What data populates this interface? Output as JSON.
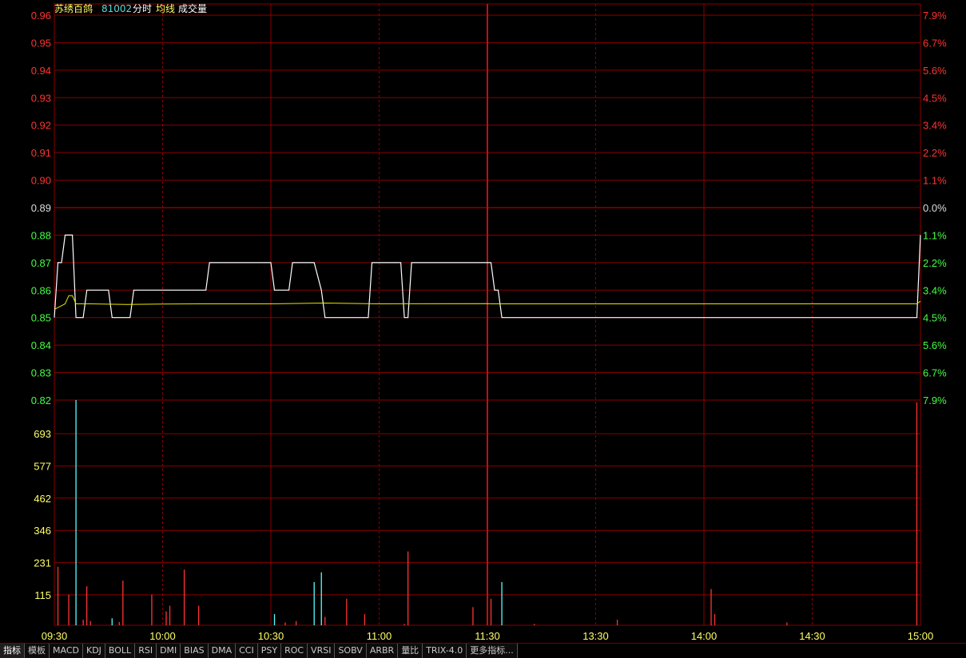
{
  "header": {
    "stock_name": "苏绣百鸽",
    "stock_code": "81002",
    "mode_label": "分时",
    "avg_label": "均线",
    "vol_label": "成交量"
  },
  "colors": {
    "price_line": "#ffffff",
    "avg_line": "#e6e600",
    "grid": "#8b0000",
    "axis_up": "#ff3333",
    "axis_flat": "#dddddd",
    "axis_down": "#44ff44",
    "vol_up": "#ff3333",
    "vol_down": "#55ffff",
    "time_label": "#ffff66"
  },
  "chart_data": [
    {
      "type": "line",
      "title": "",
      "preclose": 0.89,
      "ylim": [
        0.82,
        0.96
      ],
      "y_ticks": [
        "0.96",
        "0.95",
        "0.94",
        "0.93",
        "0.92",
        "0.91",
        "0.90",
        "0.89",
        "0.88",
        "0.87",
        "0.86",
        "0.85",
        "0.84",
        "0.83",
        "0.82"
      ],
      "y_right_ticks": [
        "7.9%",
        "6.7%",
        "5.6%",
        "4.5%",
        "3.4%",
        "2.2%",
        "1.1%",
        "0.0%",
        "1.1%",
        "2.2%",
        "3.4%",
        "4.5%",
        "5.6%",
        "6.7%",
        "7.9%"
      ],
      "x_range_minutes": [
        0,
        240
      ],
      "x_labels": [
        {
          "label": "09:30",
          "minute": 0
        },
        {
          "label": "10:00",
          "minute": 30
        },
        {
          "label": "10:30",
          "minute": 60
        },
        {
          "label": "11:00",
          "minute": 90
        },
        {
          "label": "11:30",
          "minute": 120
        },
        {
          "label": "13:30",
          "minute": 150
        },
        {
          "label": "14:00",
          "minute": 180
        },
        {
          "label": "14:30",
          "minute": 210
        },
        {
          "label": "15:00",
          "minute": 240
        }
      ],
      "series": [
        {
          "key": "price",
          "points": [
            [
              0,
              0.85
            ],
            [
              1,
              0.87
            ],
            [
              2,
              0.87
            ],
            [
              3,
              0.88
            ],
            [
              5,
              0.88
            ],
            [
              6,
              0.85
            ],
            [
              8,
              0.85
            ],
            [
              9,
              0.86
            ],
            [
              15,
              0.86
            ],
            [
              16,
              0.85
            ],
            [
              21,
              0.85
            ],
            [
              22,
              0.86
            ],
            [
              42,
              0.86
            ],
            [
              43,
              0.87
            ],
            [
              60,
              0.87
            ],
            [
              61,
              0.86
            ],
            [
              65,
              0.86
            ],
            [
              66,
              0.87
            ],
            [
              72,
              0.87
            ],
            [
              74,
              0.86
            ],
            [
              75,
              0.85
            ],
            [
              87,
              0.85
            ],
            [
              88,
              0.87
            ],
            [
              96,
              0.87
            ],
            [
              97,
              0.85
            ],
            [
              98,
              0.85
            ],
            [
              99,
              0.87
            ],
            [
              121,
              0.87
            ],
            [
              122,
              0.86
            ],
            [
              123,
              0.86
            ],
            [
              124,
              0.85
            ],
            [
              239,
              0.85
            ],
            [
              240,
              0.88
            ]
          ]
        },
        {
          "key": "average",
          "points": [
            [
              0,
              0.853
            ],
            [
              3,
              0.855
            ],
            [
              4,
              0.858
            ],
            [
              5,
              0.858
            ],
            [
              6,
              0.855
            ],
            [
              10,
              0.855
            ],
            [
              20,
              0.8548
            ],
            [
              30,
              0.8549
            ],
            [
              40,
              0.855
            ],
            [
              60,
              0.855
            ],
            [
              75,
              0.8553
            ],
            [
              90,
              0.855
            ],
            [
              120,
              0.8551
            ],
            [
              121,
              0.855
            ],
            [
              180,
              0.855
            ],
            [
              239,
              0.855
            ],
            [
              240,
              0.856
            ]
          ]
        }
      ]
    },
    {
      "type": "bar",
      "title": "",
      "ylim": [
        0,
        808
      ],
      "y_ticks": [
        693,
        577,
        462,
        346,
        231,
        115
      ],
      "bars": [
        {
          "minute": 1,
          "volume": 210,
          "dir": "up"
        },
        {
          "minute": 4,
          "volume": 110,
          "dir": "up"
        },
        {
          "minute": 6,
          "volume": 808,
          "dir": "down"
        },
        {
          "minute": 8,
          "volume": 20,
          "dir": "up"
        },
        {
          "minute": 9,
          "volume": 140,
          "dir": "up"
        },
        {
          "minute": 10,
          "volume": 15,
          "dir": "up"
        },
        {
          "minute": 16,
          "volume": 25,
          "dir": "down"
        },
        {
          "minute": 18,
          "volume": 12,
          "dir": "up"
        },
        {
          "minute": 19,
          "volume": 160,
          "dir": "up"
        },
        {
          "minute": 27,
          "volume": 110,
          "dir": "up"
        },
        {
          "minute": 31,
          "volume": 50,
          "dir": "up"
        },
        {
          "minute": 32,
          "volume": 70,
          "dir": "up"
        },
        {
          "minute": 36,
          "volume": 200,
          "dir": "up"
        },
        {
          "minute": 40,
          "volume": 70,
          "dir": "up"
        },
        {
          "minute": 61,
          "volume": 40,
          "dir": "down"
        },
        {
          "minute": 64,
          "volume": 10,
          "dir": "up"
        },
        {
          "minute": 67,
          "volume": 15,
          "dir": "up"
        },
        {
          "minute": 72,
          "volume": 155,
          "dir": "down"
        },
        {
          "minute": 74,
          "volume": 190,
          "dir": "down"
        },
        {
          "minute": 75,
          "volume": 30,
          "dir": "up"
        },
        {
          "minute": 81,
          "volume": 95,
          "dir": "up"
        },
        {
          "minute": 86,
          "volume": 40,
          "dir": "up"
        },
        {
          "minute": 97,
          "volume": 5,
          "dir": "up"
        },
        {
          "minute": 98,
          "volume": 265,
          "dir": "up"
        },
        {
          "minute": 116,
          "volume": 65,
          "dir": "up"
        },
        {
          "minute": 121,
          "volume": 95,
          "dir": "up"
        },
        {
          "minute": 124,
          "volume": 155,
          "dir": "down"
        },
        {
          "minute": 133,
          "volume": 5,
          "dir": "up"
        },
        {
          "minute": 156,
          "volume": 20,
          "dir": "up"
        },
        {
          "minute": 182,
          "volume": 130,
          "dir": "up"
        },
        {
          "minute": 183,
          "volume": 40,
          "dir": "up"
        },
        {
          "minute": 203,
          "volume": 10,
          "dir": "up"
        },
        {
          "minute": 239,
          "volume": 800,
          "dir": "up"
        }
      ]
    }
  ],
  "tabs": [
    "指标",
    "模板",
    "MACD",
    "KDJ",
    "BOLL",
    "RSI",
    "DMI",
    "BIAS",
    "DMA",
    "CCI",
    "PSY",
    "ROC",
    "VRSI",
    "SOBV",
    "ARBR",
    "量比",
    "TRIX-4.0",
    "更多指标..."
  ]
}
